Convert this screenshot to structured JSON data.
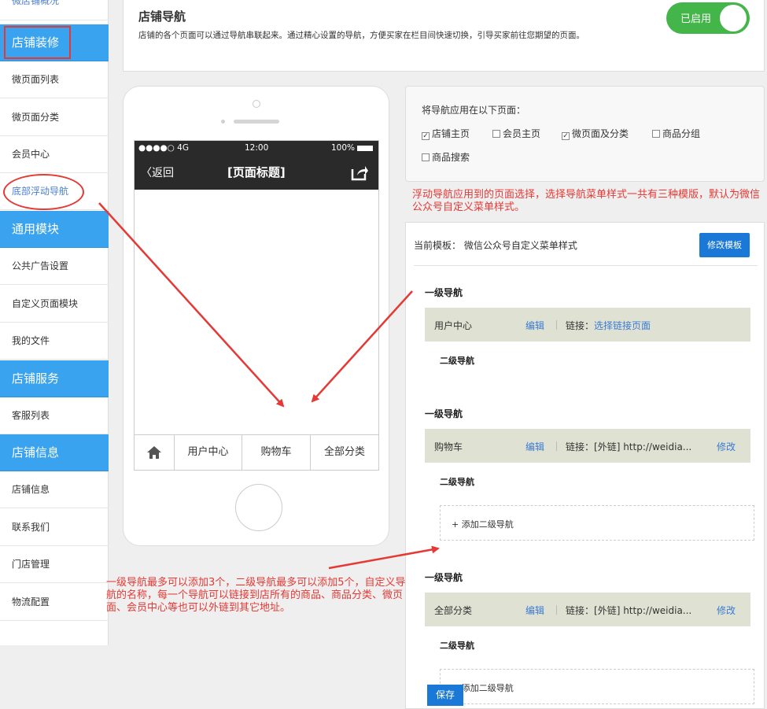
{
  "sidebar": {
    "items": [
      {
        "label": "微店铺概况",
        "type": "link"
      },
      {
        "label": "店铺装修",
        "type": "section"
      },
      {
        "label": "微页面列表",
        "type": "item"
      },
      {
        "label": "微页面分类",
        "type": "item"
      },
      {
        "label": "会员中心",
        "type": "item"
      },
      {
        "label": "底部浮动导航",
        "type": "link"
      },
      {
        "label": "通用模块",
        "type": "section"
      },
      {
        "label": "公共广告设置",
        "type": "item"
      },
      {
        "label": "自定义页面模块",
        "type": "item"
      },
      {
        "label": "我的文件",
        "type": "item"
      },
      {
        "label": "店铺服务",
        "type": "section"
      },
      {
        "label": "客服列表",
        "type": "item"
      },
      {
        "label": "店铺信息",
        "type": "section"
      },
      {
        "label": "店铺信息",
        "type": "item"
      },
      {
        "label": "联系我们",
        "type": "item"
      },
      {
        "label": "门店管理",
        "type": "item"
      },
      {
        "label": "物流配置",
        "type": "item"
      }
    ]
  },
  "header": {
    "title": "店铺导航",
    "description": "店铺的各个页面可以通过导航串联起来。通过精心设置的导航，方便买家在栏目间快速切换，引导买家前往您期望的页面。",
    "toggle_label": "已启用"
  },
  "phone": {
    "signal": "●●●●○ 4G",
    "time": "12:00",
    "battery": "100%",
    "back": "〈返回",
    "page_title": "[页面标题]",
    "nav": [
      "用户中心",
      "购物车",
      "全部分类"
    ]
  },
  "apply": {
    "label": "将导航应用在以下页面：",
    "options": [
      {
        "label": "店铺主页",
        "checked": true
      },
      {
        "label": "会员主页",
        "checked": false
      },
      {
        "label": "微页面及分类",
        "checked": true
      },
      {
        "label": "商品分组",
        "checked": false
      },
      {
        "label": "商品搜索",
        "checked": false
      }
    ]
  },
  "editor": {
    "current_template": "当前模板：  微信公众号自定义菜单样式",
    "modify_template": "修改模板",
    "level1_label": "一级导航",
    "level2_label": "二级导航",
    "edit_label": "编辑",
    "modify_label": "修改",
    "add_sub_label": "+ 添加二级导航",
    "save_label": "保存",
    "navs": [
      {
        "name": "用户中心",
        "link_prefix": "链接：",
        "link": "选择链接页面"
      },
      {
        "name": "购物车",
        "link_prefix": "链接：",
        "link": "[外链] http://weidia..."
      },
      {
        "name": "全部分类",
        "link_prefix": "链接：",
        "link": "[外链] http://weidia..."
      }
    ]
  },
  "annotations": {
    "note1": "浮动导航应用到的页面选择，选择导航菜单样式一共有三种模版，默认为微信公众号自定义菜单样式。",
    "note2": "一级导航最多可以添加3个，二级导航最多可以添加5个，自定义导航的名称，每一个导航可以链接到店所有的商品、商品分类、微页面、会员中心等也可以外链到其它地址。"
  },
  "colors": {
    "section": "#3aa3f0",
    "toggle": "#44b549",
    "primary": "#1a78d6",
    "annotation": "#e53935",
    "nav_row": "#dfe1d2"
  }
}
